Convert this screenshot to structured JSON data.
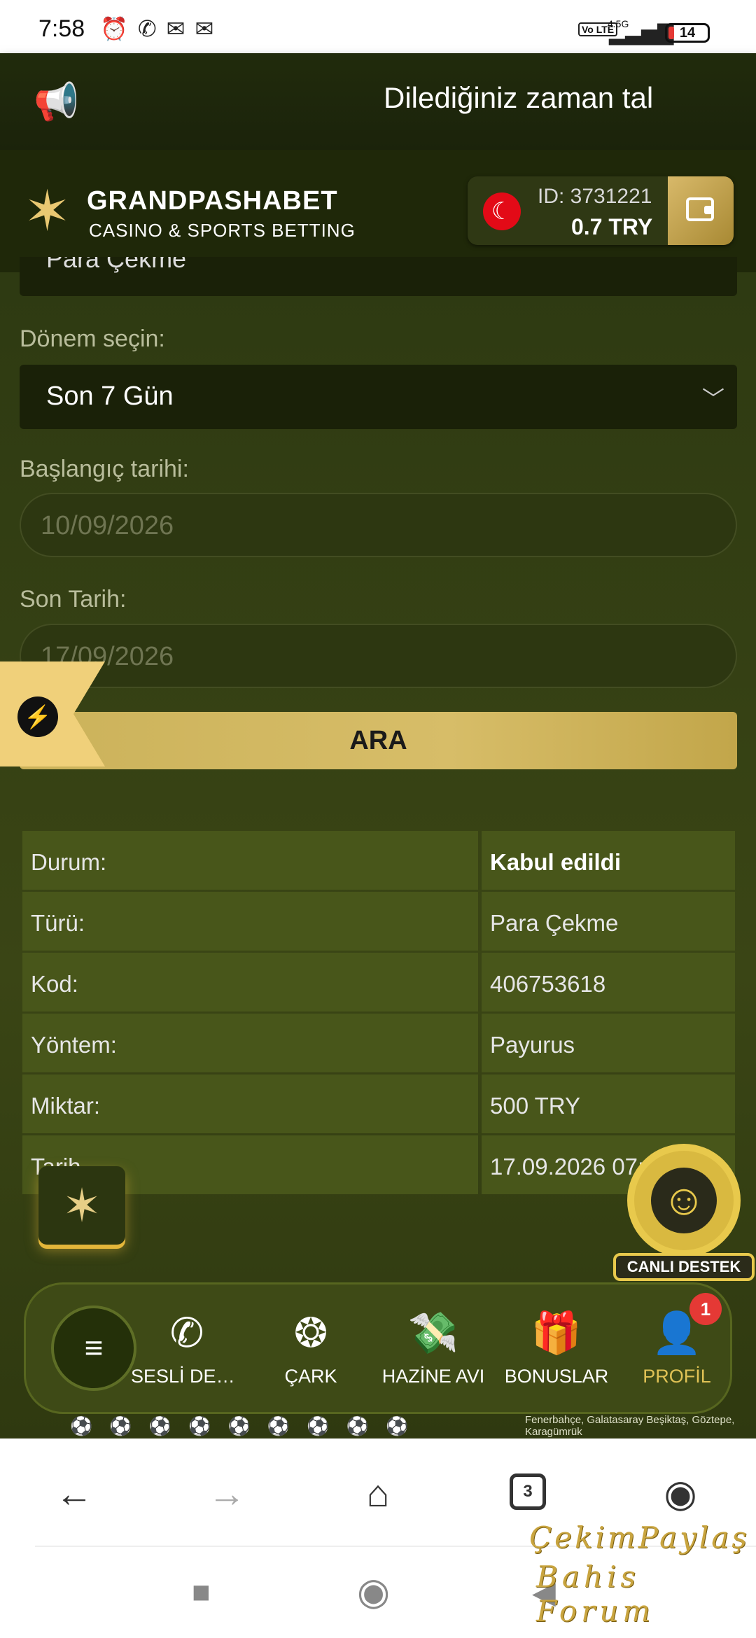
{
  "status_bar": {
    "time": "7:58",
    "network": "4.5G",
    "volte": "Vo LTE",
    "battery": "14"
  },
  "marquee": {
    "text": "Dilediğiniz zaman tal"
  },
  "brand": {
    "name": "GRANDPASHABET",
    "subtitle": "CASINO & SPORTS BETTING"
  },
  "account": {
    "id": "ID: 3731221",
    "balance": "0.7   TRY"
  },
  "form": {
    "type_select_value": "Para Çekme",
    "period_label": "Dönem seçin:",
    "period_value": "Son 7 Gün",
    "start_label": "Başlangıç tarihi:",
    "start_value": "10/09/2026",
    "end_label": "Son Tarih:",
    "end_value": "17/09/2026",
    "search_button": "ARA"
  },
  "details": [
    {
      "key": "Durum:",
      "value": "Kabul edildi"
    },
    {
      "key": "Türü:",
      "value": "Para Çekme"
    },
    {
      "key": "Kod:",
      "value": "406753618"
    },
    {
      "key": "Yöntem:",
      "value": "Payurus"
    },
    {
      "key": "Miktar:",
      "value": "500 TRY"
    },
    {
      "key": "Tarih",
      "value": "17.09.2026 07:"
    }
  ],
  "live_support": {
    "label": "CANLI DESTEK"
  },
  "bottom_nav": {
    "items": [
      {
        "label": "SESLİ DES...",
        "icon": "phone-icon"
      },
      {
        "label": "ÇARK",
        "icon": "wheel-icon"
      },
      {
        "label": "HAZİNE AVI",
        "icon": "money-icon"
      },
      {
        "label": "BONUSLAR",
        "icon": "gift-icon"
      },
      {
        "label": "PROFİL",
        "icon": "user-icon"
      }
    ],
    "profile_badge": "1"
  },
  "sponsors": {
    "text": "Fenerbahçe, Galatasaray Beşiktaş, Göztepe, Karagümrük"
  },
  "browser": {
    "tab_count": "3"
  },
  "watermark": {
    "line1": "ÇekimPaylaş",
    "line2": "Bahis Forum"
  },
  "colors": {
    "accent_gold": "#d7bd68",
    "background": "#2f3a12",
    "badge": "#e53935"
  }
}
